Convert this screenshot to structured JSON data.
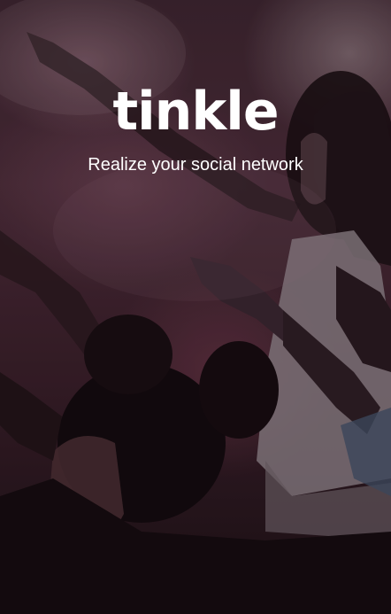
{
  "brand": {
    "logo_text": "tinkle",
    "tagline": "Realize your social network"
  },
  "colors": {
    "text": "#ffffff",
    "background_tint": "#3d2530"
  }
}
